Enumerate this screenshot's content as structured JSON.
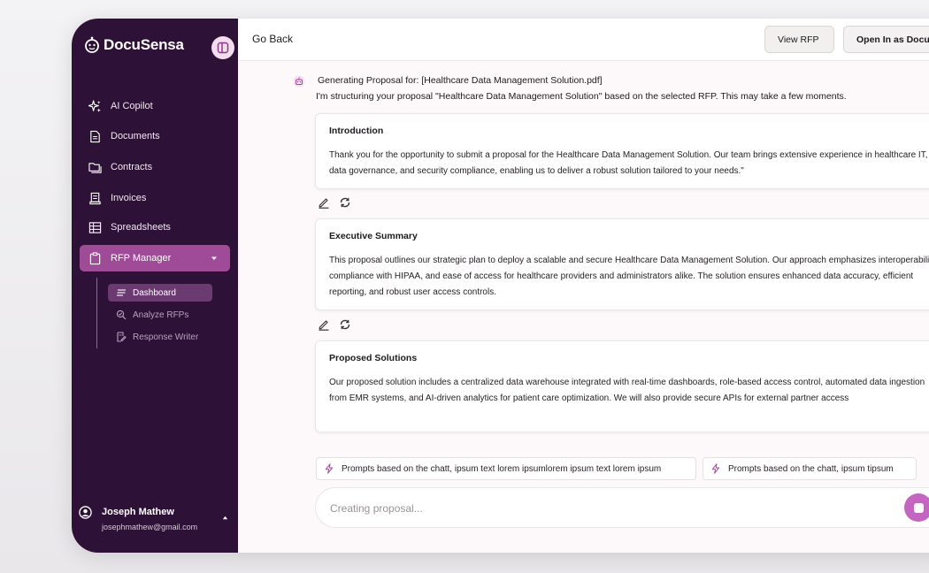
{
  "app": {
    "name": "DocuSensa"
  },
  "sidebar": {
    "items": [
      {
        "label": "AI Copilot",
        "icon": "sparkles-icon"
      },
      {
        "label": "Documents",
        "icon": "document-icon"
      },
      {
        "label": "Contracts",
        "icon": "folders-icon"
      },
      {
        "label": "Invoices",
        "icon": "receipt-icon"
      },
      {
        "label": "Spreadsheets",
        "icon": "table-icon"
      },
      {
        "label": "RFP Manager",
        "icon": "clipboard-icon",
        "active": true,
        "expanded": true
      }
    ],
    "subitems": [
      {
        "label": "Dashboard",
        "icon": "lines-icon",
        "active": true
      },
      {
        "label": "Analyze RFPs",
        "icon": "analyze-icon"
      },
      {
        "label": "Response Writer",
        "icon": "writer-icon"
      }
    ],
    "user": {
      "name": "Joseph Mathew",
      "email": "josephmathew@gmail.com"
    }
  },
  "header": {
    "back_label": "Go Back",
    "view_rfp_label": "View RFP",
    "open_label": "Open In as Document"
  },
  "proposal": {
    "status": "Generating Proposal for: [Healthcare Data Management Solution.pdf]",
    "description": "I'm structuring your proposal \"Healthcare Data Management Solution\" based on the selected RFP. This may take a few moments.",
    "sections": [
      {
        "title": "Introduction",
        "body": "Thank you for the opportunity to submit a proposal for the Healthcare Data Management Solution. Our team brings extensive experience in healthcare IT, data governance, and security compliance, enabling us to deliver a robust solution tailored to your needs.\""
      },
      {
        "title": "Executive Summary",
        "body": "This proposal outlines our strategic plan to deploy a scalable and secure Healthcare Data Management Solution. Our approach emphasizes interoperability, compliance with HIPAA, and ease of access for healthcare providers and administrators alike. The solution ensures enhanced data accuracy, efficient reporting, and robust user access controls."
      },
      {
        "title": "Proposed Solutions",
        "body": "Our proposed solution includes a centralized data warehouse integrated with real-time dashboards, role-based access control, automated data ingestion from EMR systems, and AI-driven analytics for patient care optimization. We will also provide secure APIs for external partner access"
      }
    ]
  },
  "prompts": [
    "Prompts based on the chatt, ipsum text lorem ipsumlorem ipsum text lorem ipsum",
    "Prompts based on the chatt, ipsum tipsum"
  ],
  "composer": {
    "placeholder": "Creating proposal..."
  },
  "colors": {
    "sidebar": "#2d1136",
    "accent": "#a04b98",
    "stop_button": "#c466c0"
  }
}
